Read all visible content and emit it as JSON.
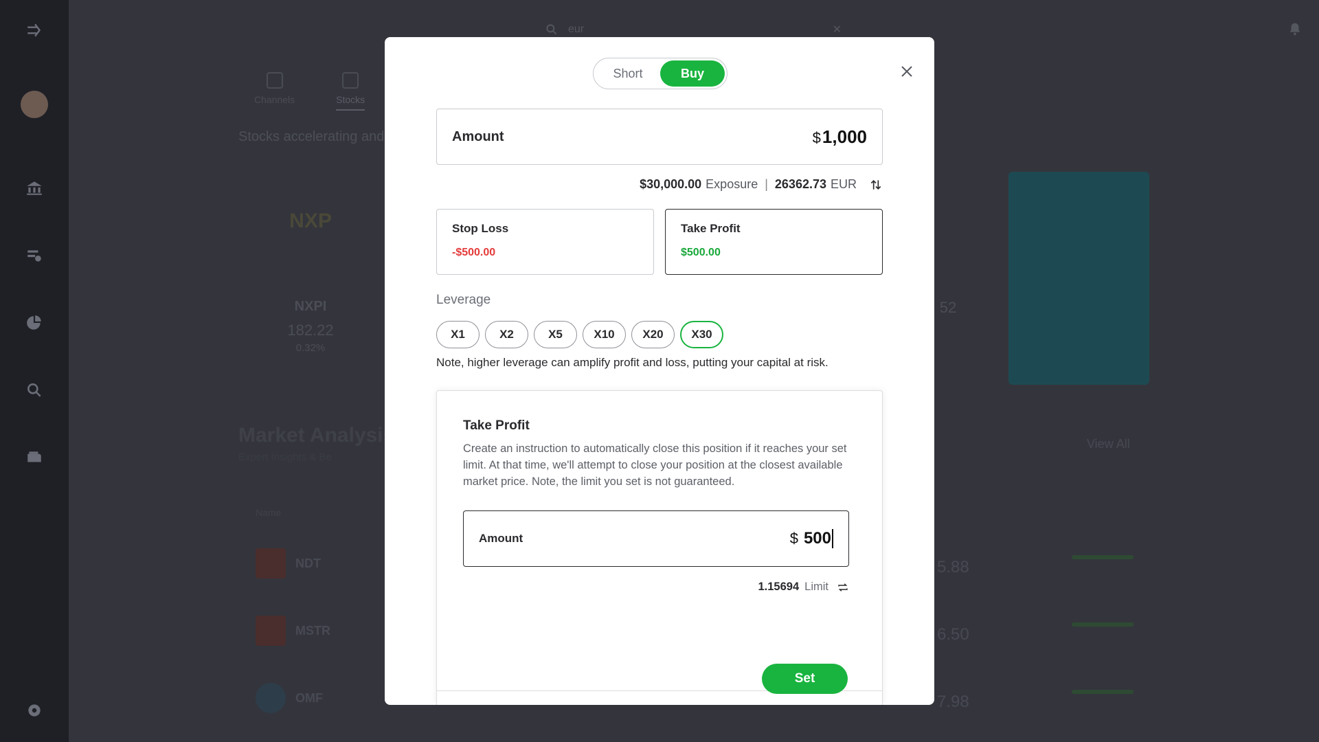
{
  "background": {
    "search_query": "eur",
    "tabs": [
      "Channels",
      "Stocks"
    ],
    "subtitle": "Stocks accelerating and",
    "cards": [
      {
        "symbol": "NXPI",
        "price": "182.22",
        "change": "0.32%"
      },
      {
        "symbol": "",
        "price": "52",
        "change": ""
      }
    ],
    "section_title": "Market Analysis",
    "section_sub": "Expert Insights & Be",
    "view_all": "View All",
    "col_head": "Name",
    "rows": [
      {
        "symbol": "NDT",
        "value": "5.88"
      },
      {
        "symbol": "MSTR",
        "value": "6.50"
      },
      {
        "symbol": "OMF",
        "value": "7.98"
      }
    ]
  },
  "modal": {
    "toggle": {
      "short_label": "Short",
      "buy_label": "Buy",
      "selected": "Buy"
    },
    "amount": {
      "label": "Amount",
      "currency": "$",
      "value": "1,000"
    },
    "exposure": {
      "value": "$30,000.00",
      "label": "Exposure",
      "eur_value": "26362.73",
      "eur_label": "EUR"
    },
    "stop_loss": {
      "label": "Stop Loss",
      "value": "-$500.00"
    },
    "take_profit": {
      "label": "Take Profit",
      "value": "$500.00"
    },
    "leverage": {
      "title": "Leverage",
      "options": [
        "X1",
        "X2",
        "X5",
        "X10",
        "X20",
        "X30"
      ],
      "selected": "X30",
      "note": "Note, higher leverage can amplify profit and loss, putting your capital at risk."
    },
    "tp_panel": {
      "title": "Take Profit",
      "description": "Create an instruction to automatically close this position if it reaches your set limit. At that time, we'll attempt to close your position at the closest available market price. Note, the limit you set is not guaranteed.",
      "amount_label": "Amount",
      "currency": "$",
      "amount_value": "500",
      "limit_value": "1.15694",
      "limit_label": "Limit"
    },
    "set_label": "Set"
  },
  "colors": {
    "accent_green": "#19b43f",
    "loss_red": "#e53b3b",
    "profit_green": "#19a83a"
  }
}
